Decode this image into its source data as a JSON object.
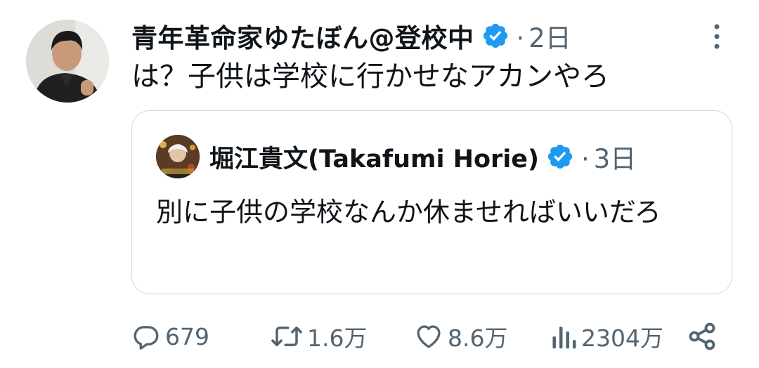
{
  "tweet": {
    "display_name": "青年革命家ゆたぼん@登校中",
    "time": "2日",
    "text": "は？子供は学校に行かせなアカンやろ"
  },
  "quote": {
    "display_name": "堀江貴文(Takafumi Horie)",
    "time": "3日",
    "text": "別に子供の学校なんか休ませればいいだろ"
  },
  "actions": {
    "replies": "679",
    "retweets": "1.6万",
    "likes": "8.6万",
    "views": "2304万"
  },
  "icons": [
    "verified-badge-icon",
    "more-icon",
    "reply-icon",
    "retweet-icon",
    "like-icon",
    "views-icon",
    "share-icon"
  ],
  "colors": {
    "verified": "#1d9bf0",
    "text": "#0f1419",
    "secondary": "#536471",
    "border": "#cfd9de"
  }
}
